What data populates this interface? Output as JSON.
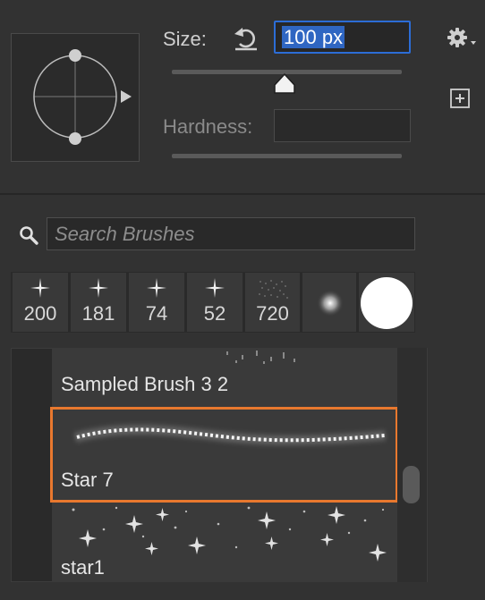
{
  "brush_settings": {
    "size_label": "Size:",
    "size_value": "100 px",
    "size_slider_fraction": 0.49,
    "hardness_label": "Hardness:",
    "hardness_value": ""
  },
  "icons": {
    "reset": "reset-icon",
    "gear": "gear-icon",
    "new_preset": "new-preset-icon",
    "search": "search-icon"
  },
  "search": {
    "placeholder": "Search Brushes",
    "value": ""
  },
  "recent_brushes": [
    {
      "size": "200",
      "kind": "star"
    },
    {
      "size": "181",
      "kind": "star"
    },
    {
      "size": "74",
      "kind": "star"
    },
    {
      "size": "52",
      "kind": "star"
    },
    {
      "size": "720",
      "kind": "texture"
    },
    {
      "size": "",
      "kind": "soft-round"
    },
    {
      "size": "",
      "kind": "hard-round"
    }
  ],
  "brush_list": {
    "items": [
      {
        "name": "Sampled Brush 3 2"
      },
      {
        "name": "Star 7"
      },
      {
        "name": "star1"
      }
    ],
    "selected": "Star 7"
  },
  "colors": {
    "selection": "#e8782e",
    "field_highlight": "#2f66c2",
    "panel_bg": "#323232"
  }
}
